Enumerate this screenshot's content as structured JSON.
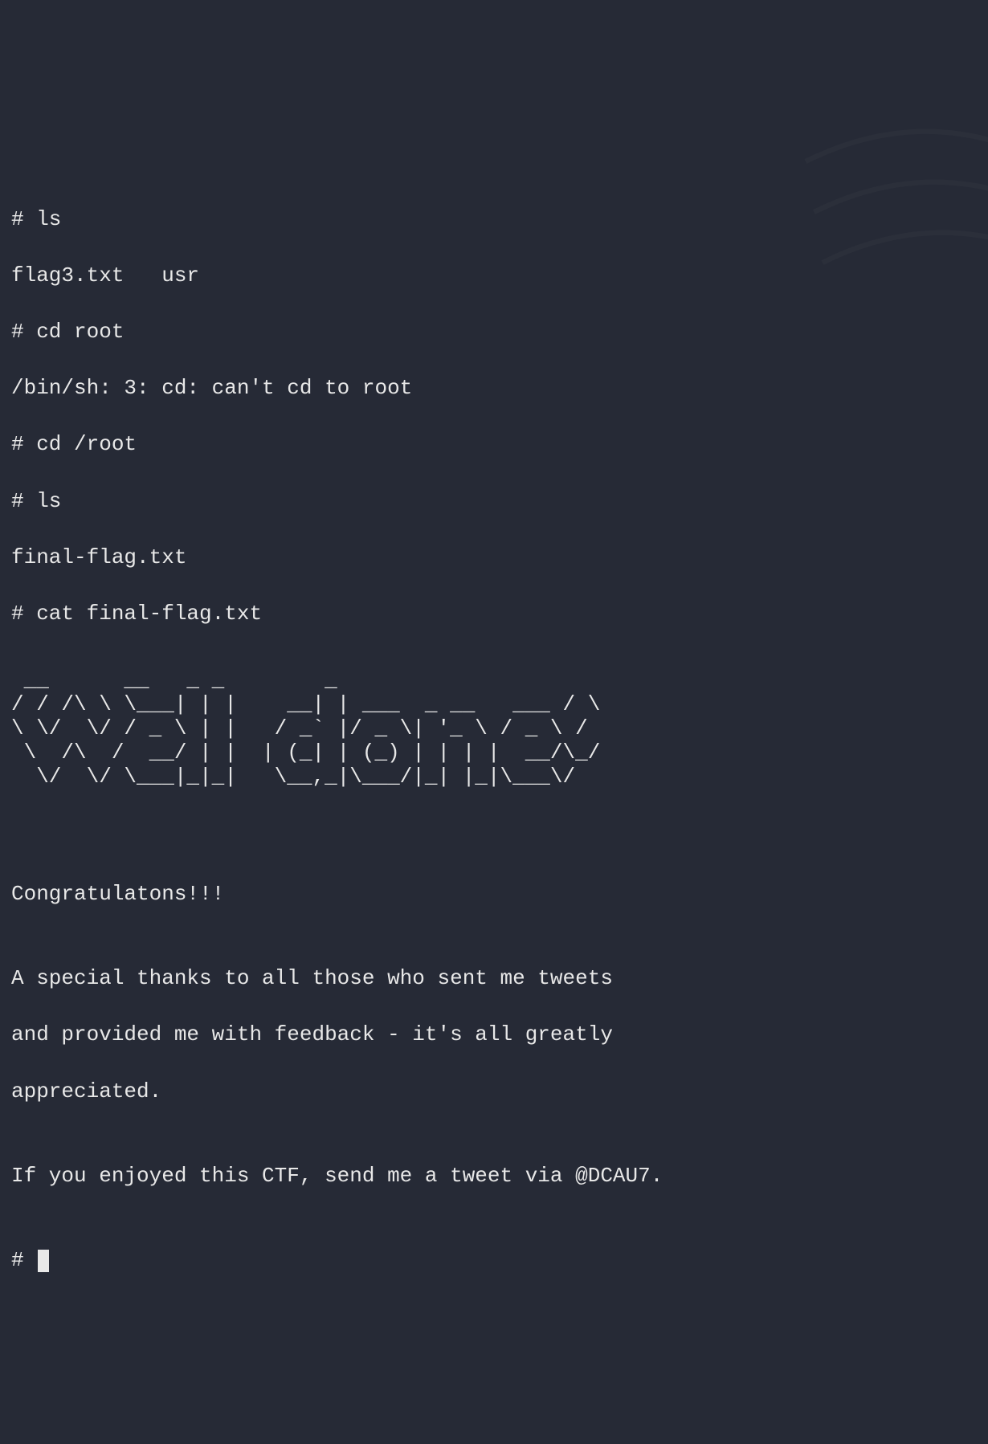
{
  "terminal": {
    "lines": [
      "# ls",
      "flag3.txt   usr",
      "# cd root",
      "/bin/sh: 3: cd: can't cd to root",
      "# cd /root",
      "# ls",
      "final-flag.txt",
      "# cat final-flag.txt"
    ],
    "ascii_art": " __      __   _ _        _                  \n/ / /\\ \\ \\___| | |    __| | ___  _ __   ___ / \\\n\\ \\/  \\/ / _ \\ | |   / _` |/ _ \\| '_ \\ / _ \\ /\n \\  /\\  /  __/ | |  | (_| | (_) | | | |  __/\\_/\n  \\/  \\/ \\___|_|_|   \\__,_|\\___/|_| |_|\\___\\/  ",
    "message_lines": [
      "",
      "",
      "Congratulatons!!!",
      "",
      "A special thanks to all those who sent me tweets",
      "and provided me with feedback - it's all greatly",
      "appreciated.",
      "",
      "If you enjoyed this CTF, send me a tweet via @DCAU7.",
      ""
    ],
    "prompt": "# "
  }
}
